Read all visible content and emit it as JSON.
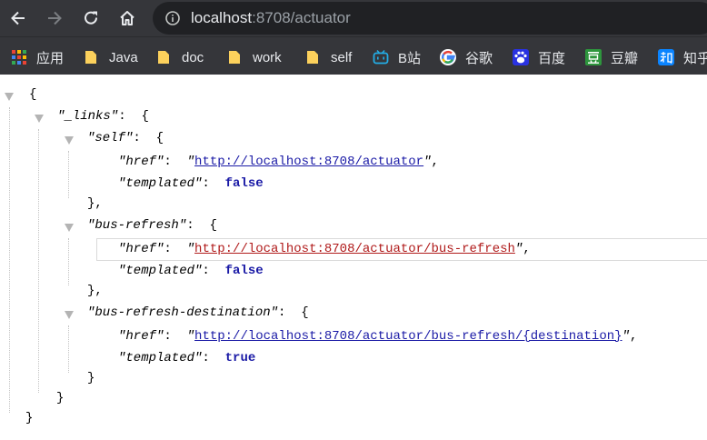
{
  "browser": {
    "url_host": "localhost",
    "url_path": ":8708/actuator",
    "bookmarks": [
      {
        "label": "应用",
        "icon": "apps-grid-icon"
      },
      {
        "label": "Java",
        "icon": "folder-icon"
      },
      {
        "label": "doc",
        "icon": "folder-icon"
      },
      {
        "label": "work",
        "icon": "folder-icon"
      },
      {
        "label": "self",
        "icon": "folder-icon"
      },
      {
        "label": "B站",
        "icon": "bilibili-icon"
      },
      {
        "label": "谷歌",
        "icon": "google-icon"
      },
      {
        "label": "百度",
        "icon": "baidu-icon"
      },
      {
        "label": "豆瓣",
        "icon": "douban-icon"
      },
      {
        "label": "知乎",
        "icon": "zhihu-icon"
      }
    ],
    "colors": {
      "chrome": "#35363a",
      "omnibox": "#202124"
    }
  },
  "json": {
    "open_brace": "{",
    "close_brace": "}",
    "links_key": "\"_links\"",
    "colon": ":",
    "comma": ",",
    "closing_comma": "},",
    "entries": [
      {
        "key": "\"self\"",
        "href_key": "\"href\"",
        "href_value": "http://localhost:8708/actuator",
        "templated_key": "\"templated\"",
        "templated_value": "false"
      },
      {
        "key": "\"bus-refresh\"",
        "href_key": "\"href\"",
        "href_value": "http://localhost:8708/actuator/bus-refresh",
        "templated_key": "\"templated\"",
        "templated_value": "false"
      },
      {
        "key": "\"bus-refresh-destination\"",
        "href_key": "\"href\"",
        "href_value": "http://localhost:8708/actuator/bus-refresh/{destination}",
        "templated_key": "\"templated\"",
        "templated_value": "true"
      }
    ]
  }
}
